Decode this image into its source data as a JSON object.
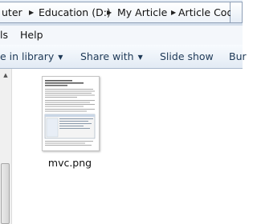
{
  "address_bar": {
    "crumbs": [
      "uter",
      "Education (D:)",
      "My Article",
      "Article Code"
    ]
  },
  "menu": {
    "items": [
      "ls",
      "Help"
    ]
  },
  "toolbar": {
    "include_label": "e in library",
    "share_label": "Share with",
    "slideshow_label": "Slide show",
    "overflow_label": "Bur"
  },
  "files": [
    {
      "name": "mvc.png"
    }
  ],
  "colors": {
    "toolbar_text": "#1e3957",
    "address_bg": "#e7eef7",
    "toolbar_bg": "#e2eaf4"
  }
}
